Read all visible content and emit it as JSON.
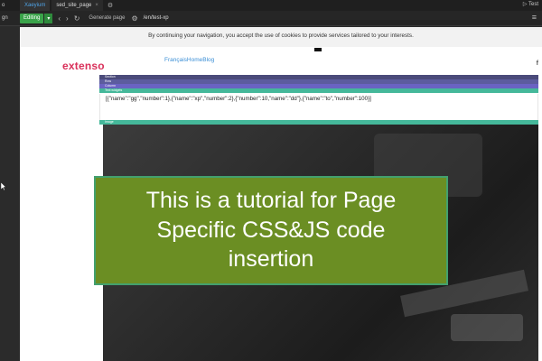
{
  "tabbar": {
    "stub": "o",
    "tabs": [
      {
        "label": "Xaeyium",
        "active": true
      },
      {
        "label": "sed_site_page",
        "active": false
      }
    ],
    "close_glyph": "×",
    "test_label": "▷ Test"
  },
  "toolbar": {
    "stub": "gn",
    "editing_label": "Editing",
    "editing_dropdown": "▾",
    "back": "‹",
    "forward": "›",
    "refresh": "↻",
    "generate_label": "Generate page",
    "path": "/en/test-xp",
    "menu": "≡"
  },
  "site": {
    "cookie_text": "By continuing your navigation, you accept the use of cookies to provide services tailored to your interests.",
    "logo": "extenso",
    "menu_text": "FrançaisHomeBlog",
    "social": "f"
  },
  "editor": {
    "strips": [
      "Section",
      "Row",
      "Column",
      "Text widgets"
    ],
    "content": "[{\"name\":\"gg\",\"number\":1},{\"name\":\"xp\",\"number\":2},{\"number\":10,\"name\":\"dd\"},{\"name\":\"to\",\"number\":100}]",
    "image_label": "Image"
  },
  "banner": {
    "lines": [
      "This is a tutorial for Page",
      "Specific CSS&JS code",
      "insertion"
    ]
  },
  "colors": {
    "accent_green": "#6b8e23",
    "logo_pink": "#d9305a",
    "link_blue": "#3b8fd6",
    "editing_green": "#3aa34a"
  }
}
